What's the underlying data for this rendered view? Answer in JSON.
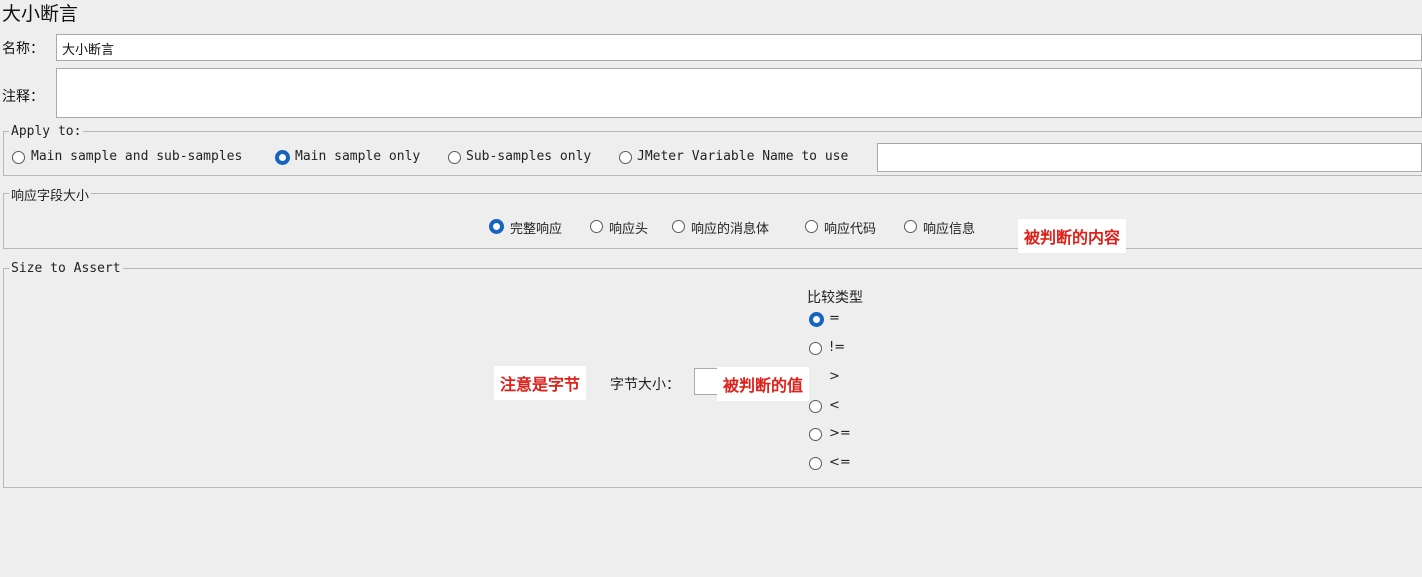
{
  "title": "大小断言",
  "name_field": {
    "label": "名称：",
    "value": "大小断言"
  },
  "comment_field": {
    "label": "注释：",
    "value": ""
  },
  "apply_to": {
    "legend": "Apply to:",
    "options": [
      "Main sample and sub-samples",
      "Main sample only",
      "Sub-samples only",
      "JMeter Variable Name to use"
    ],
    "selected": "Main sample only",
    "variable_value": ""
  },
  "response_field": {
    "legend": "响应字段大小",
    "options": [
      "完整响应",
      "响应头",
      "响应的消息体",
      "响应代码",
      "响应信息"
    ],
    "selected": "完整响应"
  },
  "size_to_assert": {
    "legend": "Size to Assert",
    "size_label": "字节大小：",
    "size_value": "",
    "comparison_title": "比较类型",
    "comparison_options": [
      "=",
      "!=",
      ">",
      "<",
      ">=",
      "<="
    ],
    "selected": "="
  },
  "annotations": {
    "response_note": "被判断的内容",
    "bytes_note": "注意是字节",
    "value_note": "被判断的值"
  }
}
